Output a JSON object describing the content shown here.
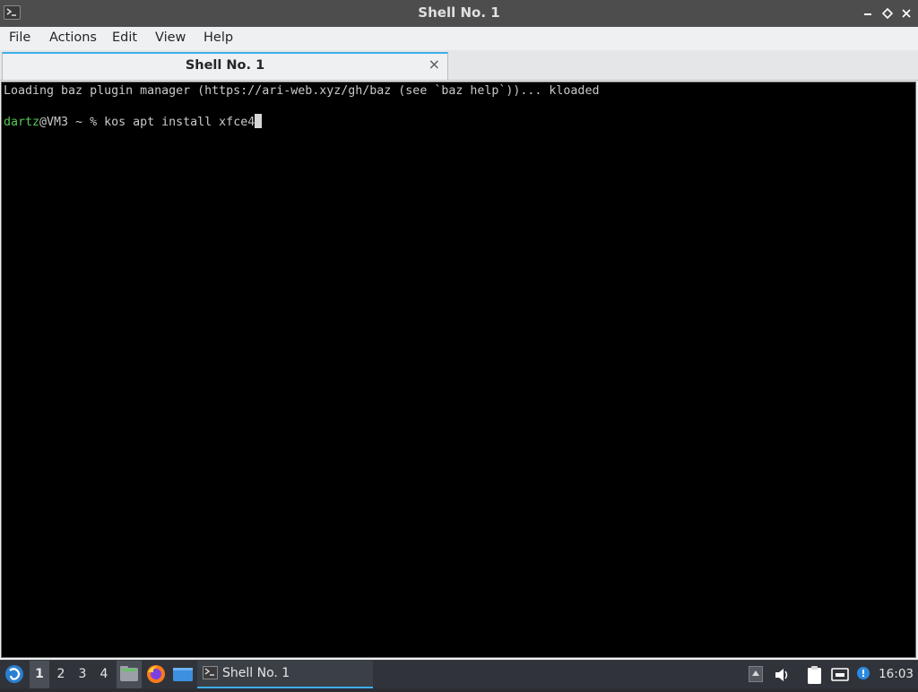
{
  "window": {
    "title": "Shell No. 1",
    "controls": {
      "minimize_icon": "minimize-icon",
      "maximize_icon": "restore-icon",
      "close_icon": "close-icon"
    }
  },
  "menubar": {
    "items": [
      "File",
      "Actions",
      "Edit",
      "View",
      "Help"
    ]
  },
  "tabs": [
    {
      "label": "Shell No. 1",
      "close_icon": "close-icon"
    }
  ],
  "terminal": {
    "line1": "Loading baz plugin manager (https://ari-web.xyz/gh/baz (see `baz help`))... kloaded",
    "prompt_user": "dartz",
    "prompt_rest": "@VM3 ~ % ",
    "command": "kos apt install xfce4"
  },
  "taskbar": {
    "desktops": [
      "1",
      "2",
      "3",
      "4"
    ],
    "active_desktop": "1",
    "launchers": [
      "file-manager-icon",
      "firefox-icon",
      "show-desktop-icon"
    ],
    "task_label": "Shell No. 1",
    "tray_icons": [
      "tray-arrow-icon",
      "volume-icon",
      "clipboard-icon",
      "network-icon",
      "notification-icon"
    ],
    "clock": "16:03"
  },
  "colors": {
    "accent": "#3daee9",
    "prompt_user": "#54c954",
    "terminal_bg": "#000000",
    "titlebar_bg": "#4d4d4d"
  }
}
